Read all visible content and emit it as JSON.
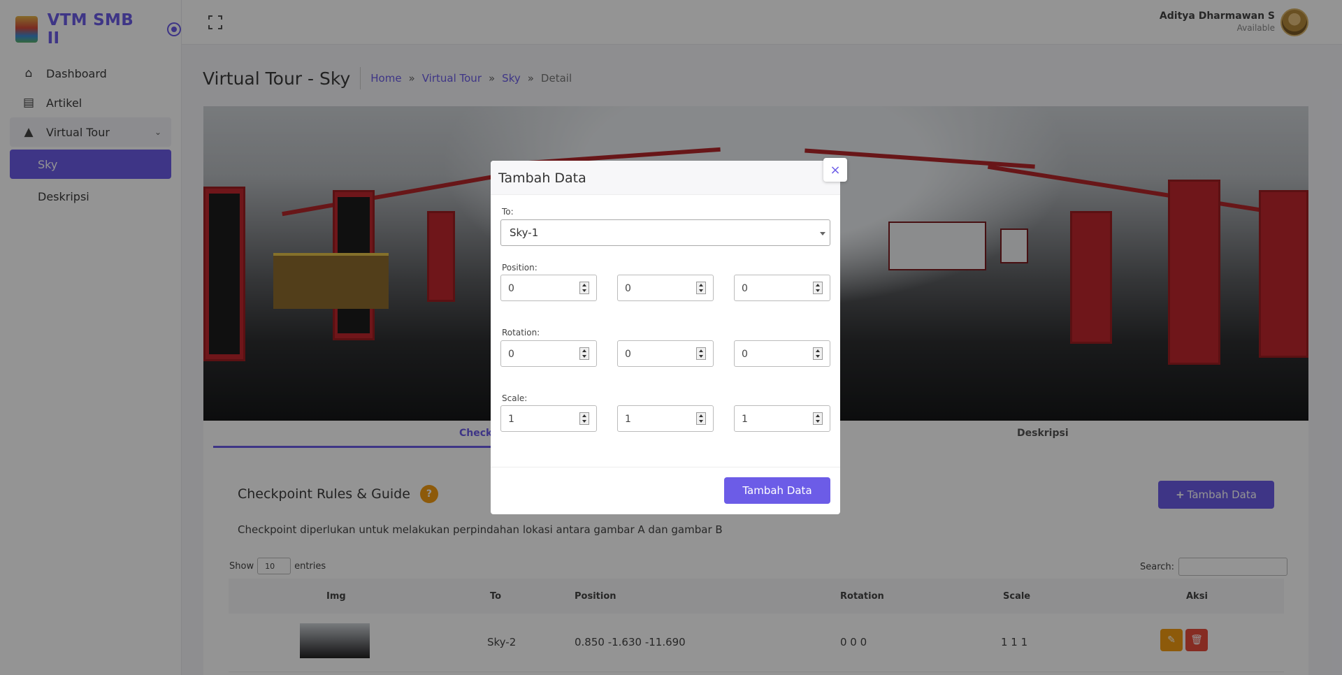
{
  "sidebar": {
    "brand": "VTM SMB II",
    "items": [
      {
        "label": "Dashboard",
        "icon": "home-icon"
      },
      {
        "label": "Artikel",
        "icon": "newspaper-icon"
      },
      {
        "label": "Virtual Tour",
        "icon": "road-icon"
      }
    ],
    "sub_items": [
      {
        "label": "Sky",
        "active": true
      },
      {
        "label": "Deskripsi",
        "active": false
      }
    ]
  },
  "user": {
    "name": "Aditya Dharmawan S",
    "status": "Available"
  },
  "page": {
    "title": "Virtual Tour - Sky",
    "breadcrumb": [
      "Home",
      "Virtual Tour",
      "Sky",
      "Detail"
    ],
    "breadcrumb_sep": "»"
  },
  "tabs": [
    "Checkpoint",
    "Deskripsi"
  ],
  "section": {
    "title": "Checkpoint Rules & Guide",
    "help": "?",
    "description": "Checkpoint diperlukan untuk melakukan perpindahan lokasi antara gambar A dan gambar B",
    "add_button": "Tambah Data",
    "add_plus": "+"
  },
  "table": {
    "show_label": "Show",
    "entries_value": "10",
    "entries_label": "entries",
    "search_label": "Search:",
    "headers": [
      "Img",
      "To",
      "Position",
      "Rotation",
      "Scale",
      "Aksi"
    ],
    "rows": [
      {
        "to": "Sky-2",
        "position": "0.850 -1.630 -11.690",
        "rotation": "0 0 0",
        "scale": "1 1 1"
      }
    ]
  },
  "modal": {
    "title": "Tambah Data",
    "close": "×",
    "to_label": "To:",
    "to_value": "Sky-1",
    "position_label": "Position:",
    "position": [
      "0",
      "0",
      "0"
    ],
    "rotation_label": "Rotation:",
    "rotation": [
      "0",
      "0",
      "0"
    ],
    "scale_label": "Scale:",
    "scale": [
      "1",
      "1",
      "1"
    ],
    "submit": "Tambah Data"
  },
  "colors": {
    "accent": "#6c5ce7",
    "warning": "#f39c12",
    "danger": "#e74c3c"
  }
}
